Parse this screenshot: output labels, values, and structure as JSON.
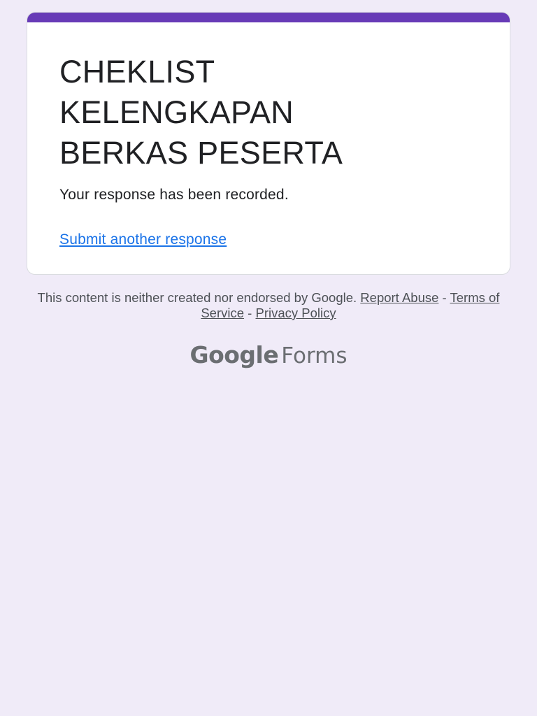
{
  "form": {
    "title_lines": [
      "CHEKLIST",
      "KELENGKAPAN",
      "BERKAS PESERTA"
    ],
    "confirmation_message": "Your response has been recorded.",
    "submit_another_label": "Submit another response"
  },
  "footer": {
    "disclaimer_text": "This content is neither created nor endorsed by Google.",
    "report_abuse_label": "Report Abuse",
    "separator": " - ",
    "terms_label": "Terms of Service",
    "privacy_label": "Privacy Policy"
  },
  "logo": {
    "brand": "Google",
    "product": "Forms"
  },
  "colors": {
    "page_background": "#f0ebf8",
    "accent": "#673ab7",
    "link": "#1a73e8"
  }
}
